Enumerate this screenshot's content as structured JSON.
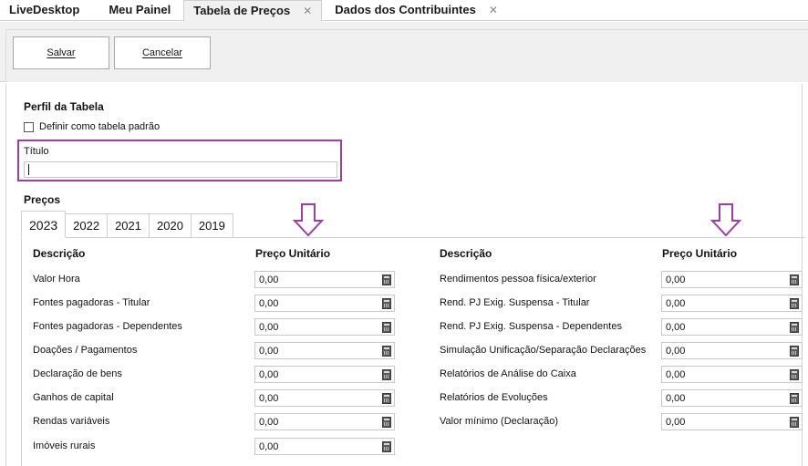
{
  "tabs": [
    {
      "label": "LiveDesktop",
      "active": false,
      "closable": false
    },
    {
      "label": "Meu Painel",
      "active": false,
      "closable": false
    },
    {
      "label": "Tabela de Preços",
      "active": true,
      "closable": true
    },
    {
      "label": "Dados dos Contribuintes",
      "active": false,
      "closable": true
    }
  ],
  "toolbar": {
    "save_label": "Salvar",
    "cancel_label": "Cancelar"
  },
  "profile": {
    "section_title": "Perfil da Tabela",
    "default_checkbox_label": "Definir como tabela padrão",
    "default_checked": false,
    "title_label": "Título",
    "title_value": ""
  },
  "prices": {
    "section_title": "Preços",
    "years": [
      "2023",
      "2022",
      "2021",
      "2020",
      "2019"
    ],
    "active_year": "2023",
    "left": {
      "desc_header": "Descrição",
      "price_header": "Preço Unitário",
      "rows": [
        {
          "label": "Valor Hora",
          "value": "0,00"
        },
        {
          "label": "Fontes pagadoras - Titular",
          "value": "0,00"
        },
        {
          "label": "Fontes pagadoras - Dependentes",
          "value": "0,00"
        },
        {
          "label": "Doações / Pagamentos",
          "value": "0,00"
        },
        {
          "label": "Declaração de bens",
          "value": "0,00"
        },
        {
          "label": "Ganhos de capital",
          "value": "0,00"
        },
        {
          "label": "Rendas variáveis",
          "value": "0,00"
        },
        {
          "label": "Imóveis rurais",
          "value": "0,00"
        }
      ]
    },
    "right": {
      "desc_header": "Descrição",
      "price_header": "Preço Unitário",
      "rows": [
        {
          "label": "Rendimentos pessoa física/exterior",
          "value": "0,00"
        },
        {
          "label": "Rend. PJ Exig. Suspensa - Titular",
          "value": "0,00"
        },
        {
          "label": "Rend. PJ Exig. Suspensa - Dependentes",
          "value": "0,00"
        },
        {
          "label": "Simulação Unificação/Separação Declarações",
          "value": "0,00"
        },
        {
          "label": "Relatórios de Análise do Caixa",
          "value": "0,00"
        },
        {
          "label": "Relatórios de Evoluções",
          "value": "0,00"
        },
        {
          "label": "Valor mínimo (Declaração)",
          "value": "0,00"
        }
      ]
    }
  },
  "colors": {
    "highlight": "#9c3fa4",
    "arrow": "#9c3fa4"
  },
  "icons": {
    "field_button": "calculator-icon",
    "annotation": "down-arrow-icon",
    "tab_close": "close-icon"
  }
}
